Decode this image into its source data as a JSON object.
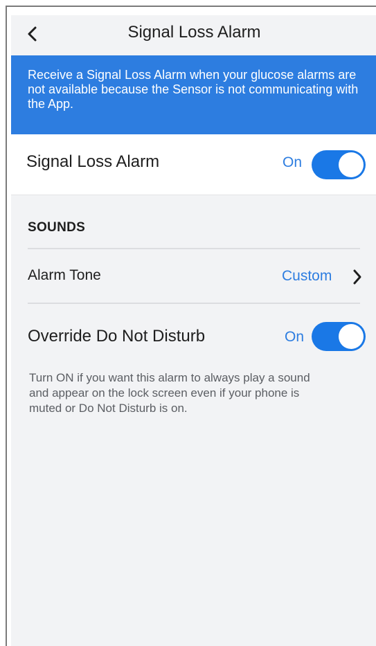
{
  "header": {
    "title": "Signal Loss Alarm"
  },
  "icons": {
    "back": "chevron-left-icon",
    "tone_chevron": "chevron-right-icon"
  },
  "banner": {
    "text": "Receive a Signal Loss Alarm when your glucose alarms are not available because the Sensor is not communicating with the App."
  },
  "signal_loss": {
    "label": "Signal Loss Alarm",
    "state_text": "On",
    "enabled": true
  },
  "sounds": {
    "header": "SOUNDS",
    "alarm_tone": {
      "label": "Alarm Tone",
      "value": "Custom"
    },
    "override_dnd": {
      "label": "Override Do Not Disturb",
      "state_text": "On",
      "enabled": true
    },
    "helper_text": "Turn ON if you want this alarm to always play a sound and appear on the lock screen even if your phone is muted or Do Not Disturb is on."
  },
  "colors": {
    "accent": "#2d7de0",
    "toggle_on": "#1a78e6",
    "background": "#f2f3f5"
  }
}
